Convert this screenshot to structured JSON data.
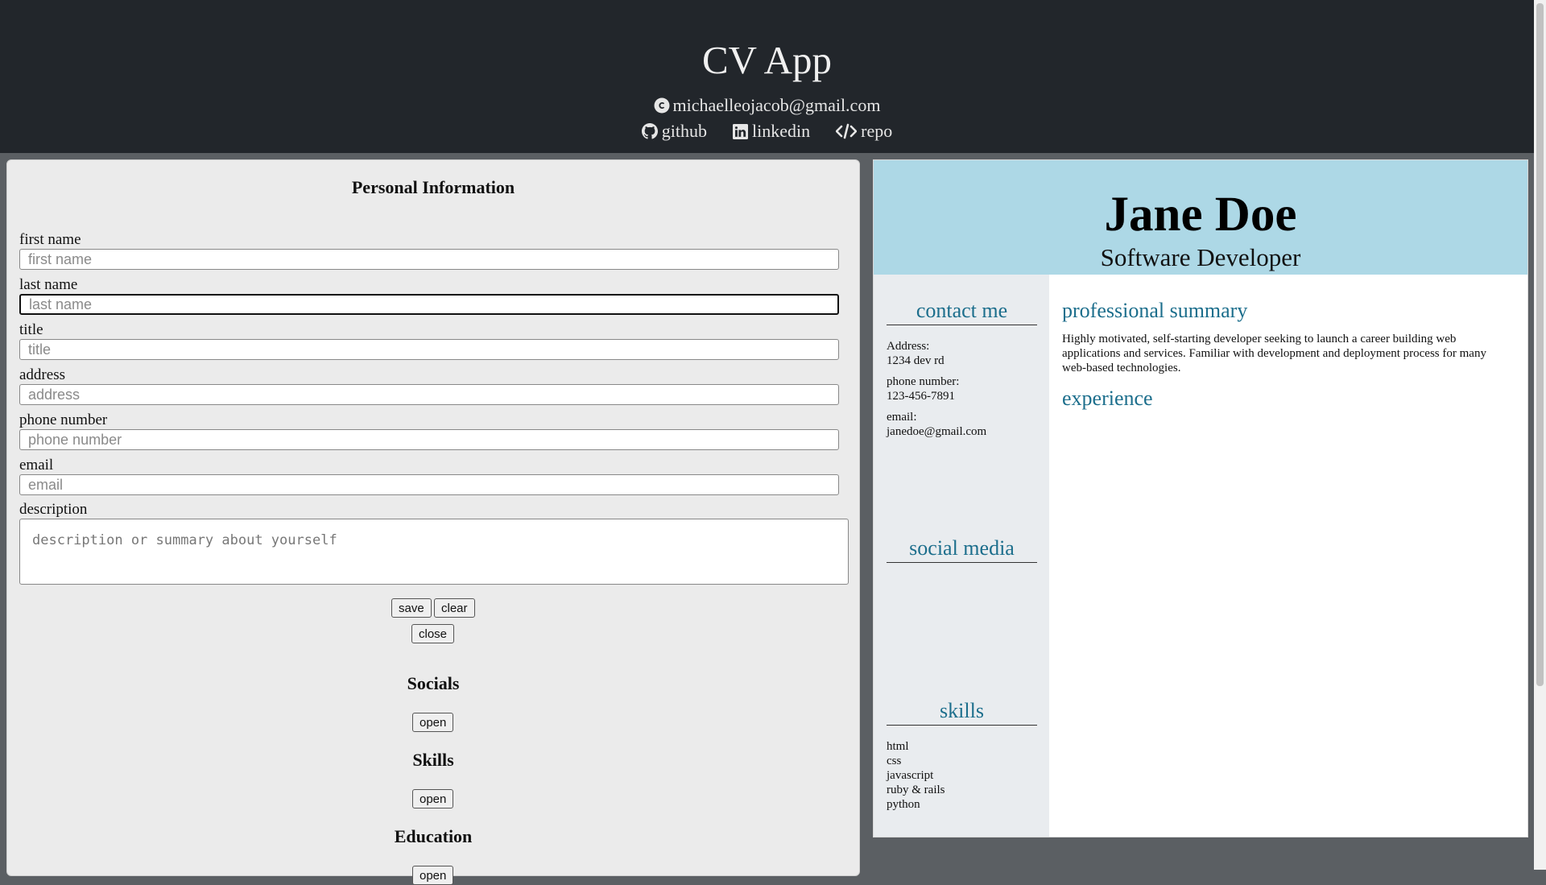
{
  "header": {
    "app_title": "CV App",
    "email": "michaelleojacob@gmail.com",
    "links": [
      {
        "label": "github",
        "icon": "github-icon"
      },
      {
        "label": "linkedin",
        "icon": "linkedin-icon"
      },
      {
        "label": "repo",
        "icon": "code-icon"
      }
    ]
  },
  "form": {
    "heading": "Personal Information",
    "fields": {
      "first_name": {
        "label": "first name",
        "placeholder": "first name",
        "value": ""
      },
      "last_name": {
        "label": "last name",
        "placeholder": "last name",
        "value": ""
      },
      "title": {
        "label": "title",
        "placeholder": "title",
        "value": ""
      },
      "address": {
        "label": "address",
        "placeholder": "address",
        "value": ""
      },
      "phone": {
        "label": "phone number",
        "placeholder": "phone number",
        "value": ""
      },
      "email": {
        "label": "email",
        "placeholder": "email",
        "value": ""
      },
      "description": {
        "label": "description",
        "placeholder": "description or summary about yourself",
        "value": ""
      }
    },
    "buttons": {
      "save": "save",
      "clear": "clear",
      "close": "close"
    },
    "sections": {
      "socials": {
        "heading": "Socials",
        "button": "open"
      },
      "skills": {
        "heading": "Skills",
        "button": "open"
      },
      "education": {
        "heading": "Education",
        "button": "open"
      }
    }
  },
  "cv": {
    "name": "Jane Doe",
    "title": "Software Developer",
    "contact": {
      "heading": "contact me",
      "address_label": "Address:",
      "address": "1234 dev rd",
      "phone_label": "phone number:",
      "phone": "123-456-7891",
      "email_label": "email:",
      "email": "janedoe@gmail.com"
    },
    "social_heading": "social media",
    "skills_heading": "skills",
    "skills": [
      "html",
      "css",
      "javascript",
      "ruby & rails",
      "python"
    ],
    "summary_heading": "professional summary",
    "summary": "Highly motivated, self-starting developer seeking to launch a career building web applications and services. Familiar with development and deployment process for many web-based technologies.",
    "experience_heading": "experience"
  },
  "colors": {
    "header_bg": "#22262b",
    "cv_header_bg": "#add8e6",
    "cv_accent": "#1c6e8c",
    "cv_sidebar_bg": "#e9ecef"
  }
}
